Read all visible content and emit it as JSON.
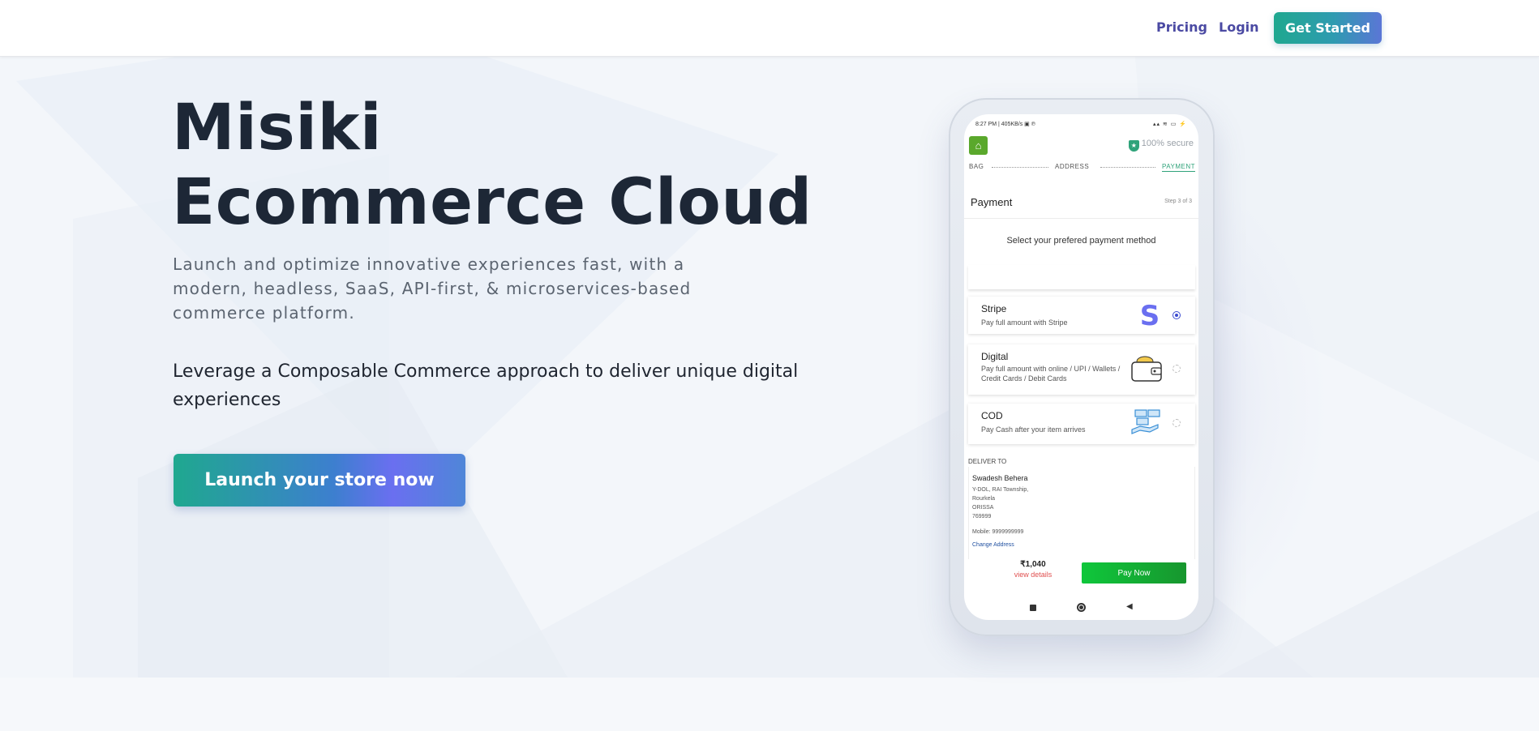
{
  "header": {
    "nav": {
      "pricing": "Pricing",
      "login": "Login"
    },
    "cta": "Get Started"
  },
  "hero": {
    "title_line1": "Misiki",
    "title_line2": "Ecommerce Cloud",
    "subtitle": "Launch and optimize innovative experiences fast, with a modern, headless, SaaS, API-first, & microservices-based commerce platform.",
    "lead": "Leverage a Composable Commerce approach to deliver unique digital experiences",
    "cta": "Launch your store now"
  },
  "phone": {
    "status_left": "8:27 PM | 405KB/s ▣ ℗",
    "status_right": "▴▴ ≋ ▭ ⚡",
    "secure": "100% secure",
    "steps": {
      "bag": "BAG",
      "address": "ADDRESS",
      "payment": "PAYMENT"
    },
    "payment_title": "Payment",
    "step_indicator": "Step 3 of 3",
    "select_text": "Select your prefered payment method",
    "methods": [
      {
        "title": "Stripe",
        "sub": "Pay full amount with Stripe",
        "selected": true
      },
      {
        "title": "Digital",
        "sub": "Pay full amount with online / UPI / Wallets / Credit Cards / Debit Cards",
        "selected": false
      },
      {
        "title": "COD",
        "sub": "Pay Cash after your item arrives",
        "selected": false
      }
    ],
    "deliver_label": "DELIVER TO",
    "address": {
      "name": "Swadesh Behera",
      "line1": "Y-DOL, RAI Township,",
      "line2": "Rourkela",
      "line3": "ORISSA",
      "line4": "769999",
      "mobile": "Mobile: 9999999999",
      "change": "Change Address"
    },
    "total": "₹1,040",
    "view_details": "view details",
    "pay_now": "Pay Now"
  },
  "colors": {
    "brand_teal": "#1fa88f",
    "brand_purple": "#6a6ff0",
    "nav_link": "#4b4aa3",
    "heading": "#1d2736"
  },
  "icons": [
    "basket-icon",
    "shield-check-icon",
    "stripe-logo-icon",
    "wallet-icon",
    "cash-icon",
    "radio-selected-icon",
    "radio-unselected-icon"
  ]
}
